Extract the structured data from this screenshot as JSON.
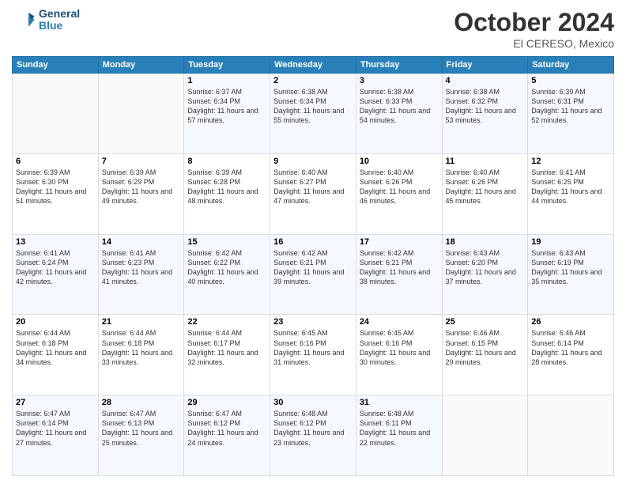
{
  "header": {
    "logo_line1": "General",
    "logo_line2": "Blue",
    "month": "October 2024",
    "location": "El CERESO, Mexico"
  },
  "weekdays": [
    "Sunday",
    "Monday",
    "Tuesday",
    "Wednesday",
    "Thursday",
    "Friday",
    "Saturday"
  ],
  "weeks": [
    [
      {
        "day": "",
        "info": ""
      },
      {
        "day": "",
        "info": ""
      },
      {
        "day": "1",
        "info": "Sunrise: 6:37 AM\nSunset: 6:34 PM\nDaylight: 11 hours and 57 minutes."
      },
      {
        "day": "2",
        "info": "Sunrise: 6:38 AM\nSunset: 6:34 PM\nDaylight: 11 hours and 55 minutes."
      },
      {
        "day": "3",
        "info": "Sunrise: 6:38 AM\nSunset: 6:33 PM\nDaylight: 11 hours and 54 minutes."
      },
      {
        "day": "4",
        "info": "Sunrise: 6:38 AM\nSunset: 6:32 PM\nDaylight: 11 hours and 53 minutes."
      },
      {
        "day": "5",
        "info": "Sunrise: 6:39 AM\nSunset: 6:31 PM\nDaylight: 11 hours and 52 minutes."
      }
    ],
    [
      {
        "day": "6",
        "info": "Sunrise: 6:39 AM\nSunset: 6:30 PM\nDaylight: 11 hours and 51 minutes."
      },
      {
        "day": "7",
        "info": "Sunrise: 6:39 AM\nSunset: 6:29 PM\nDaylight: 11 hours and 49 minutes."
      },
      {
        "day": "8",
        "info": "Sunrise: 6:39 AM\nSunset: 6:28 PM\nDaylight: 11 hours and 48 minutes."
      },
      {
        "day": "9",
        "info": "Sunrise: 6:40 AM\nSunset: 6:27 PM\nDaylight: 11 hours and 47 minutes."
      },
      {
        "day": "10",
        "info": "Sunrise: 6:40 AM\nSunset: 6:26 PM\nDaylight: 11 hours and 46 minutes."
      },
      {
        "day": "11",
        "info": "Sunrise: 6:40 AM\nSunset: 6:26 PM\nDaylight: 11 hours and 45 minutes."
      },
      {
        "day": "12",
        "info": "Sunrise: 6:41 AM\nSunset: 6:25 PM\nDaylight: 11 hours and 44 minutes."
      }
    ],
    [
      {
        "day": "13",
        "info": "Sunrise: 6:41 AM\nSunset: 6:24 PM\nDaylight: 11 hours and 42 minutes."
      },
      {
        "day": "14",
        "info": "Sunrise: 6:41 AM\nSunset: 6:23 PM\nDaylight: 11 hours and 41 minutes."
      },
      {
        "day": "15",
        "info": "Sunrise: 6:42 AM\nSunset: 6:22 PM\nDaylight: 11 hours and 40 minutes."
      },
      {
        "day": "16",
        "info": "Sunrise: 6:42 AM\nSunset: 6:21 PM\nDaylight: 11 hours and 39 minutes."
      },
      {
        "day": "17",
        "info": "Sunrise: 6:42 AM\nSunset: 6:21 PM\nDaylight: 11 hours and 38 minutes."
      },
      {
        "day": "18",
        "info": "Sunrise: 6:43 AM\nSunset: 6:20 PM\nDaylight: 11 hours and 37 minutes."
      },
      {
        "day": "19",
        "info": "Sunrise: 6:43 AM\nSunset: 6:19 PM\nDaylight: 11 hours and 35 minutes."
      }
    ],
    [
      {
        "day": "20",
        "info": "Sunrise: 6:44 AM\nSunset: 6:18 PM\nDaylight: 11 hours and 34 minutes."
      },
      {
        "day": "21",
        "info": "Sunrise: 6:44 AM\nSunset: 6:18 PM\nDaylight: 11 hours and 33 minutes."
      },
      {
        "day": "22",
        "info": "Sunrise: 6:44 AM\nSunset: 6:17 PM\nDaylight: 11 hours and 32 minutes."
      },
      {
        "day": "23",
        "info": "Sunrise: 6:45 AM\nSunset: 6:16 PM\nDaylight: 11 hours and 31 minutes."
      },
      {
        "day": "24",
        "info": "Sunrise: 6:45 AM\nSunset: 6:16 PM\nDaylight: 11 hours and 30 minutes."
      },
      {
        "day": "25",
        "info": "Sunrise: 6:46 AM\nSunset: 6:15 PM\nDaylight: 11 hours and 29 minutes."
      },
      {
        "day": "26",
        "info": "Sunrise: 6:46 AM\nSunset: 6:14 PM\nDaylight: 11 hours and 28 minutes."
      }
    ],
    [
      {
        "day": "27",
        "info": "Sunrise: 6:47 AM\nSunset: 6:14 PM\nDaylight: 11 hours and 27 minutes."
      },
      {
        "day": "28",
        "info": "Sunrise: 6:47 AM\nSunset: 6:13 PM\nDaylight: 11 hours and 25 minutes."
      },
      {
        "day": "29",
        "info": "Sunrise: 6:47 AM\nSunset: 6:12 PM\nDaylight: 11 hours and 24 minutes."
      },
      {
        "day": "30",
        "info": "Sunrise: 6:48 AM\nSunset: 6:12 PM\nDaylight: 11 hours and 23 minutes."
      },
      {
        "day": "31",
        "info": "Sunrise: 6:48 AM\nSunset: 6:11 PM\nDaylight: 11 hours and 22 minutes."
      },
      {
        "day": "",
        "info": ""
      },
      {
        "day": "",
        "info": ""
      }
    ]
  ]
}
